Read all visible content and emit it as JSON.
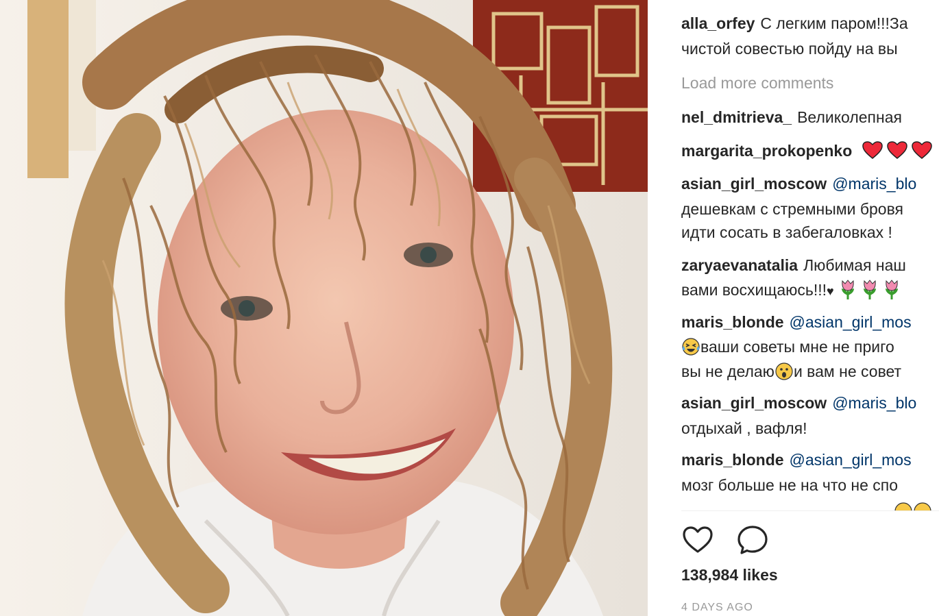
{
  "post": {
    "caption": {
      "username": "alla_orfey",
      "line1": "С легким паром!!!За",
      "line2": "чистой совестью пойду на вы"
    },
    "load_more_label": "Load more comments",
    "comments": [
      {
        "username": "nel_dmitrieva_",
        "lines": [
          "Великолепная"
        ]
      },
      {
        "username": "margarita_prokopenko",
        "lines": [
          ""
        ],
        "emoji": [
          "red-heart",
          "red-heart"
        ]
      },
      {
        "username": "asian_girl_moscow",
        "mention": "@maris_blo",
        "lines": [
          "дешевкам с стремными бровя",
          "идти сосать в забегаловках !"
        ]
      },
      {
        "username": "zaryaevanatalia",
        "lines": [
          "Любимая наш",
          "вами восхищаюсь!!!"
        ],
        "emoji": [
          "black-heart",
          "tulip",
          "tulip",
          "tulip"
        ]
      },
      {
        "username": "maris_blonde",
        "mention": "@asian_girl_mos",
        "lines": [
          "ваши советы мне не приго",
          "вы не делаю",
          "и вам не совет"
        ],
        "emoji": [
          "laughing-tears-face",
          "surprised-face"
        ]
      },
      {
        "username": "asian_girl_moscow",
        "mention": "@maris_blo",
        "lines": [
          "отдыхай , вафля!"
        ]
      },
      {
        "username": "maris_blonde",
        "mention": "@asian_girl_mos",
        "lines": [
          "мозг больше не на что не спо"
        ]
      }
    ],
    "actions": {
      "like_icon": "heart-outline-icon",
      "comment_icon": "comment-bubble-icon"
    },
    "likes_label": "138,984 likes",
    "timestamp": "4 DAYS AGO"
  },
  "colors": {
    "text": "#262626",
    "muted": "#999999",
    "mention": "#003569",
    "heart_red": "#ed2939"
  }
}
